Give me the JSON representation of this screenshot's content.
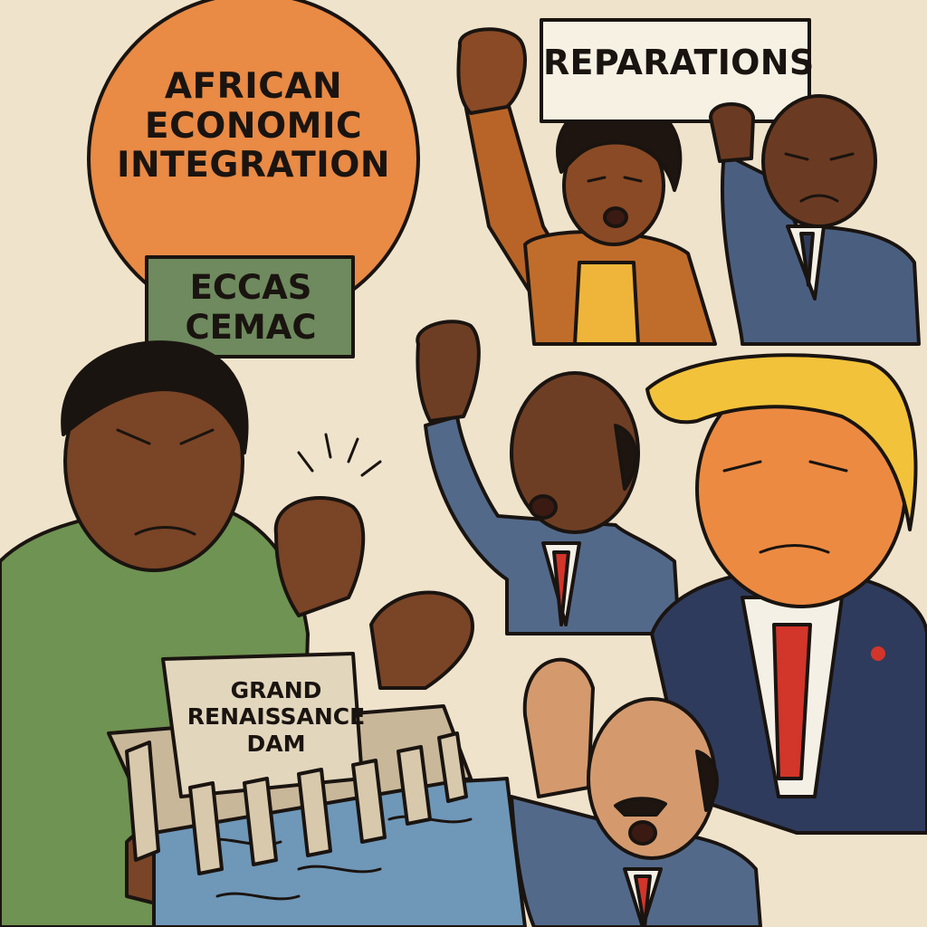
{
  "banner": {
    "lines": [
      "AFRICAN",
      "ECONOMIC",
      "INTEGRATION"
    ]
  },
  "org_sign": {
    "lines": [
      "ECCAS",
      "CEMAC"
    ]
  },
  "protest_sign": {
    "text": "REPARATIONS"
  },
  "dam_sign": {
    "lines": [
      "GRAND",
      "RENAISSANCE",
      "DAM"
    ]
  },
  "colors": {
    "paper": "#efe3cc",
    "banner_orange": "#e98a45",
    "sign_green": "#6e8a5e",
    "shirt_green": "#6f9352",
    "suit_blue": "#4a5f80",
    "suit_navy": "#2f3b5c",
    "tie_red": "#d2352a",
    "hair_yellow": "#f2c23a",
    "water_blue": "#6f97b8",
    "ink": "#1a1410"
  }
}
